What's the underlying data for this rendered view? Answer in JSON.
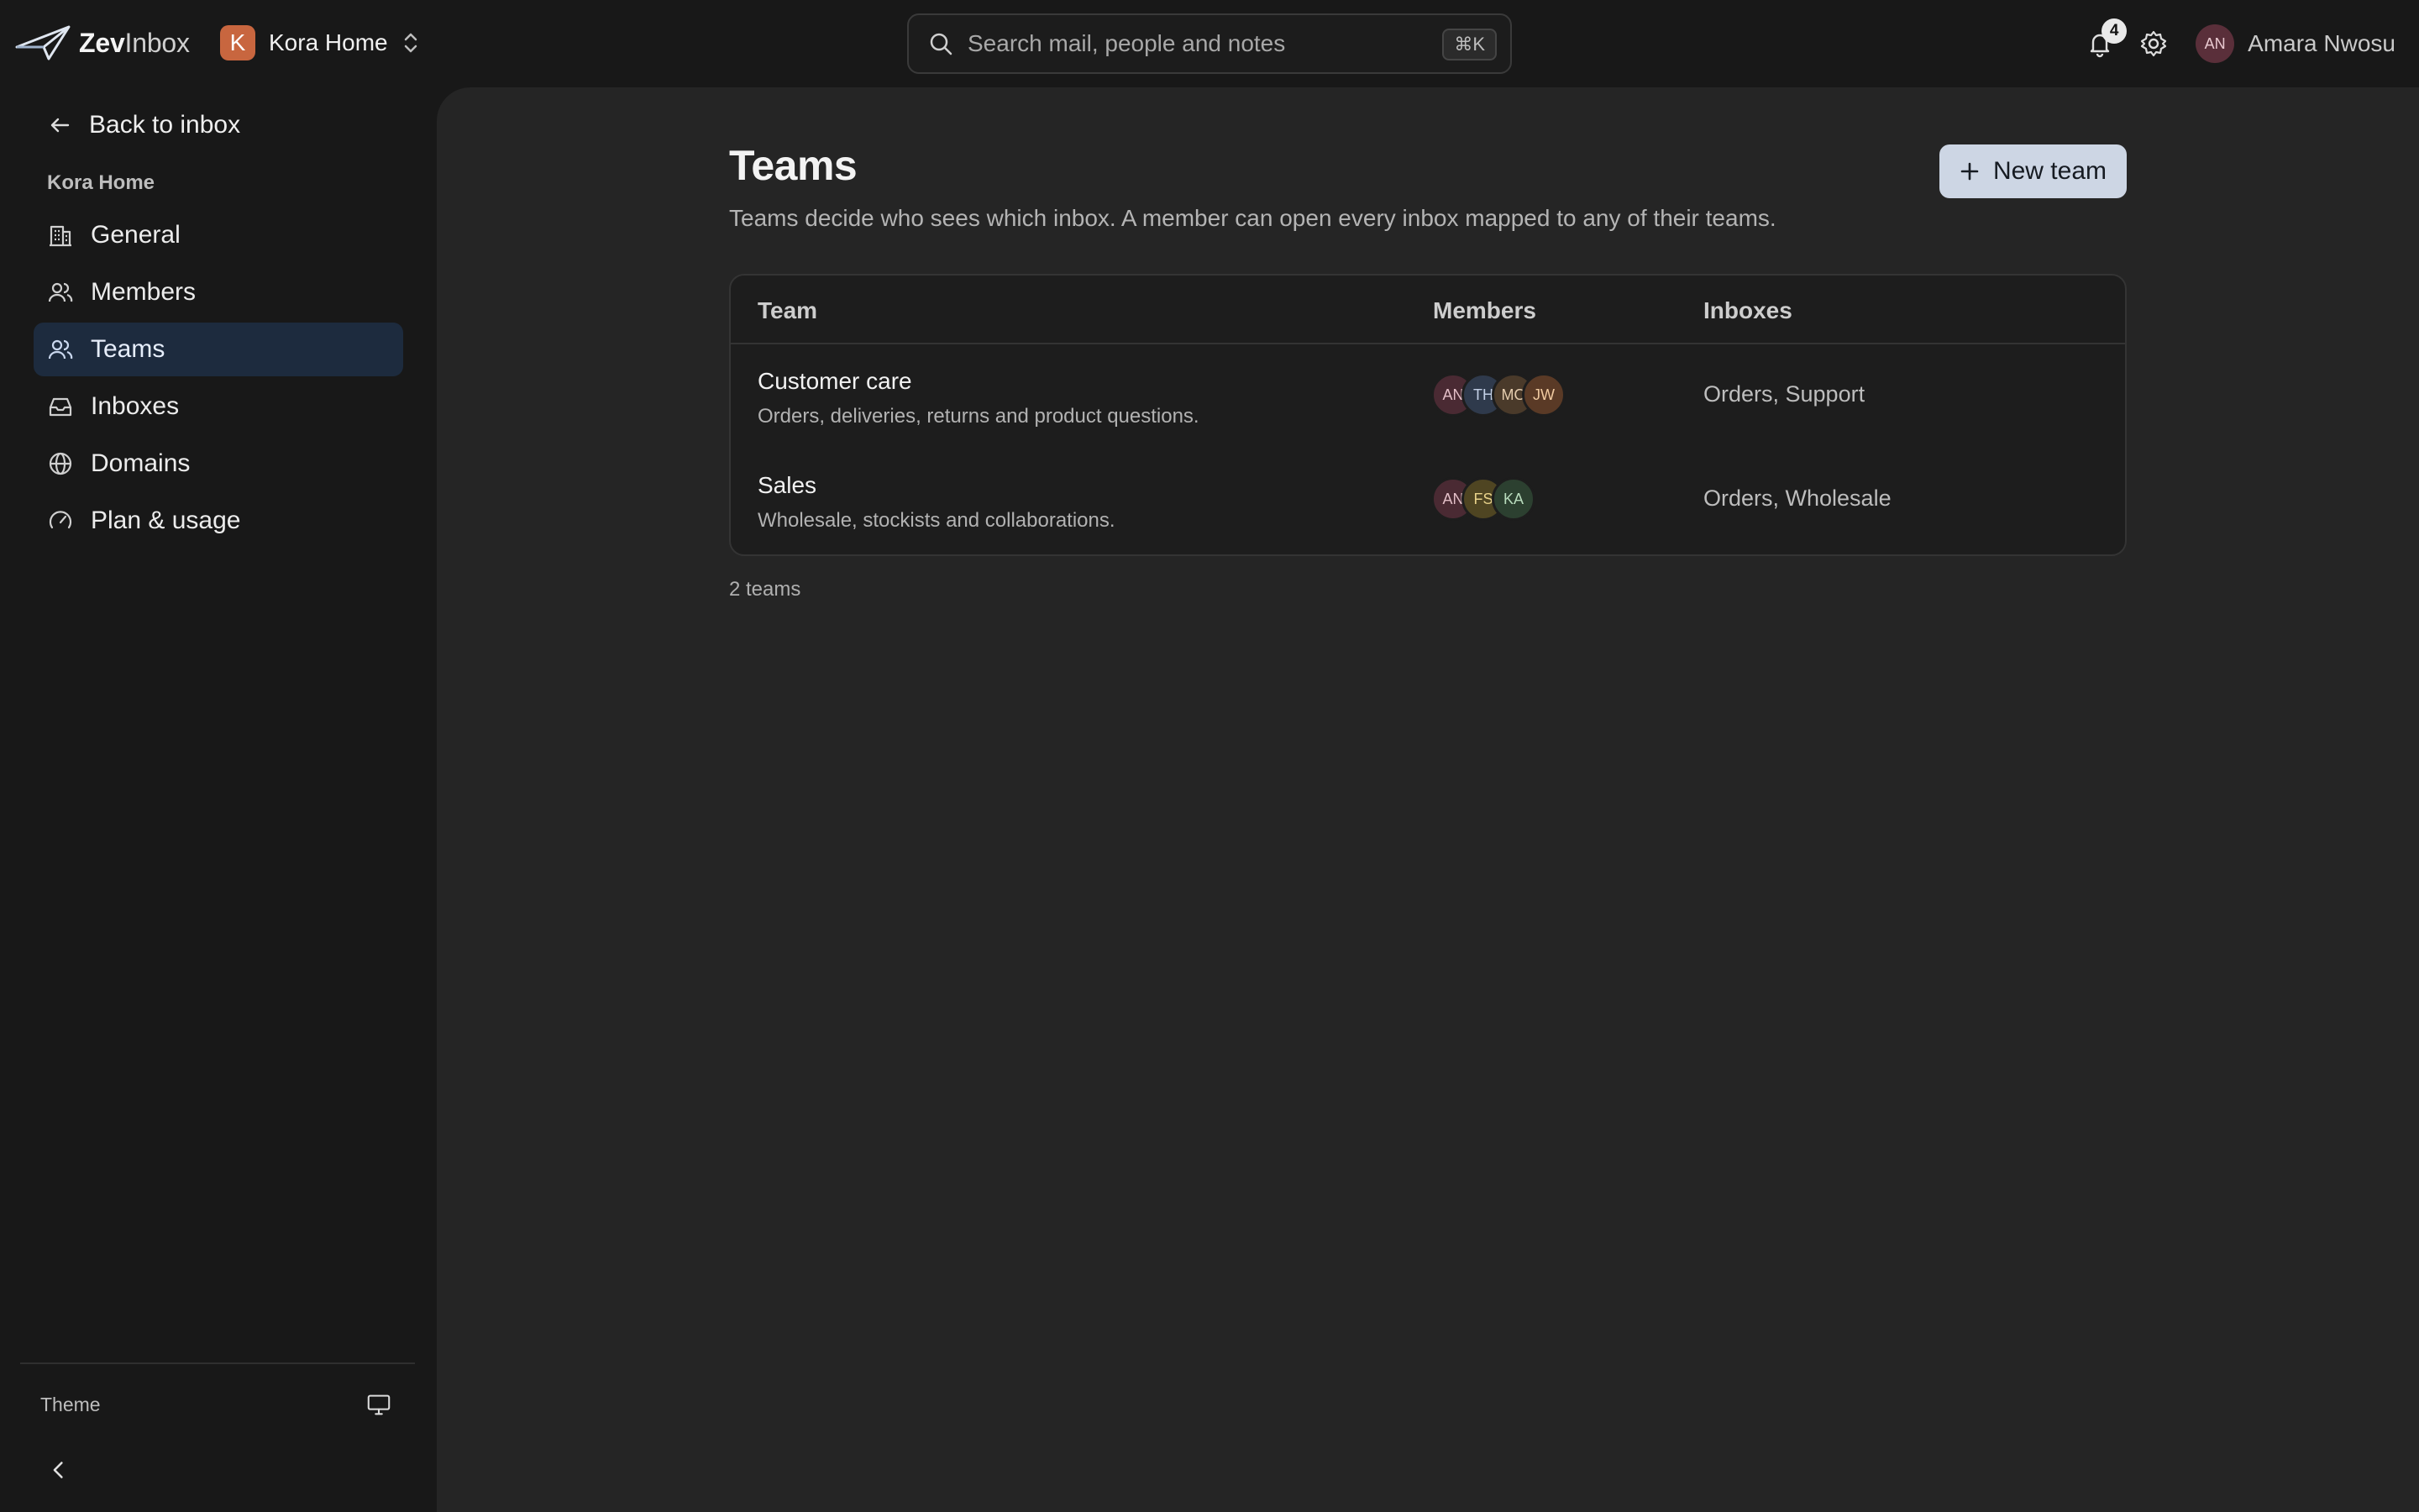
{
  "app": {
    "name_bold": "Zev",
    "name_light": "Inbox"
  },
  "workspace": {
    "initial": "K",
    "name": "Kora Home"
  },
  "search": {
    "placeholder": "Search mail, people and notes",
    "shortcut": "⌘K"
  },
  "header": {
    "notification_count": "4",
    "user_initials": "AN",
    "user_name": "Amara Nwosu"
  },
  "sidebar": {
    "back_label": "Back to inbox",
    "section_label": "Kora Home",
    "items": [
      {
        "label": "General",
        "icon": "building-icon"
      },
      {
        "label": "Members",
        "icon": "users-icon"
      },
      {
        "label": "Teams",
        "icon": "user-group-icon",
        "active": true
      },
      {
        "label": "Inboxes",
        "icon": "inbox-icon"
      },
      {
        "label": "Domains",
        "icon": "globe-icon"
      },
      {
        "label": "Plan & usage",
        "icon": "gauge-icon"
      }
    ],
    "theme_label": "Theme"
  },
  "page": {
    "title": "Teams",
    "subtitle": "Teams decide who sees which inbox. A member can open every inbox mapped to any of their teams.",
    "new_button": "New team",
    "count_label": "2 teams"
  },
  "table": {
    "columns": [
      "Team",
      "Members",
      "Inboxes"
    ],
    "rows": [
      {
        "name": "Customer care",
        "description": "Orders, deliveries, returns and product questions.",
        "members": [
          {
            "initials": "AN",
            "bg": "#4a2a33",
            "fg": "#e3bfc7"
          },
          {
            "initials": "TH",
            "bg": "#2f3a4c",
            "fg": "#c3d0e6"
          },
          {
            "initials": "MO",
            "bg": "#4a3a2a",
            "fg": "#e4ccae"
          },
          {
            "initials": "JW",
            "bg": "#5a3a26",
            "fg": "#f0caa0"
          }
        ],
        "inboxes": "Orders, Support"
      },
      {
        "name": "Sales",
        "description": "Wholesale, stockists and collaborations.",
        "members": [
          {
            "initials": "AN",
            "bg": "#4a2a33",
            "fg": "#e3bfc7"
          },
          {
            "initials": "FS",
            "bg": "#4f4522",
            "fg": "#e8d28a"
          },
          {
            "initials": "KA",
            "bg": "#2c4030",
            "fg": "#b9dcbd"
          }
        ],
        "inboxes": "Orders, Wholesale"
      }
    ]
  },
  "colors": {
    "accent_button": "#cdd6e4",
    "active_nav": "#1d2b3e",
    "workspace_badge": "#c8663f"
  }
}
